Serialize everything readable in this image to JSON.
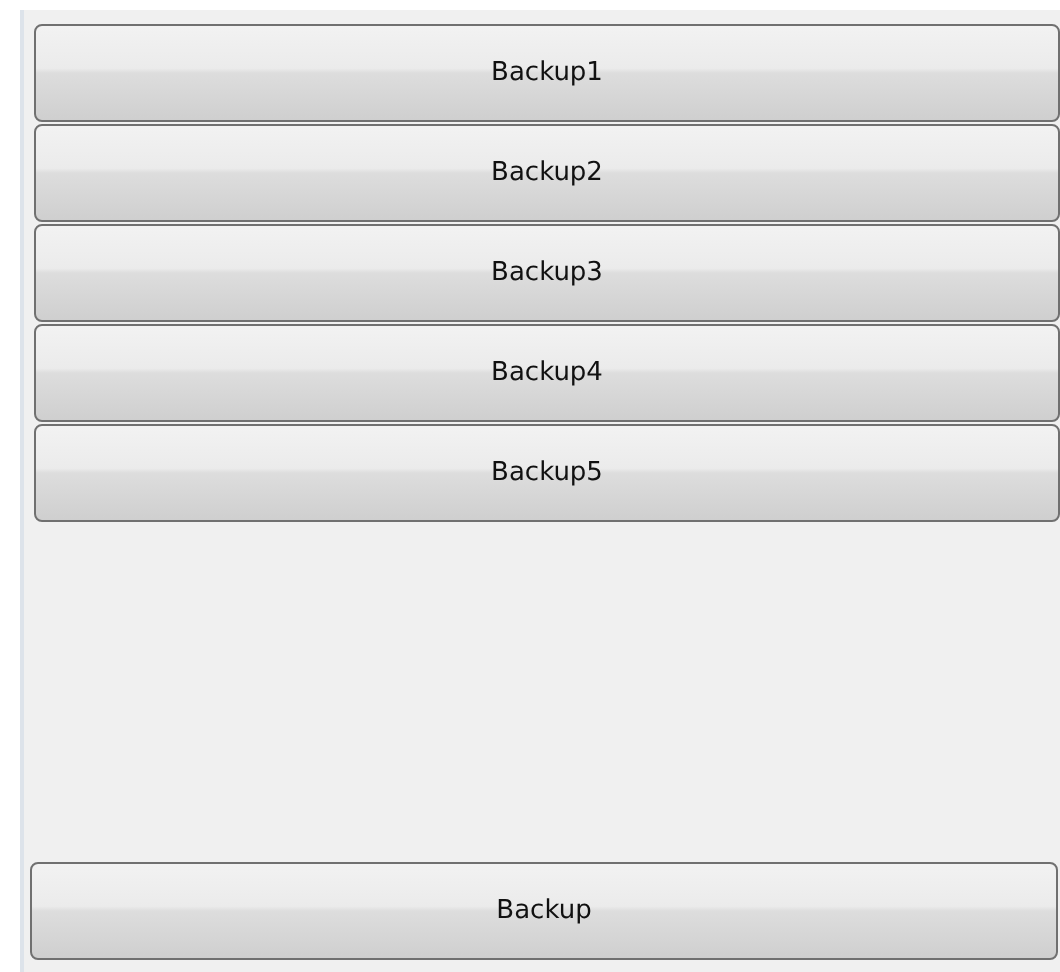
{
  "buttons": [
    {
      "label": "Backup1"
    },
    {
      "label": "Backup2"
    },
    {
      "label": "Backup3"
    },
    {
      "label": "Backup4"
    },
    {
      "label": "Backup5"
    }
  ],
  "footer_button": {
    "label": "Backup"
  }
}
